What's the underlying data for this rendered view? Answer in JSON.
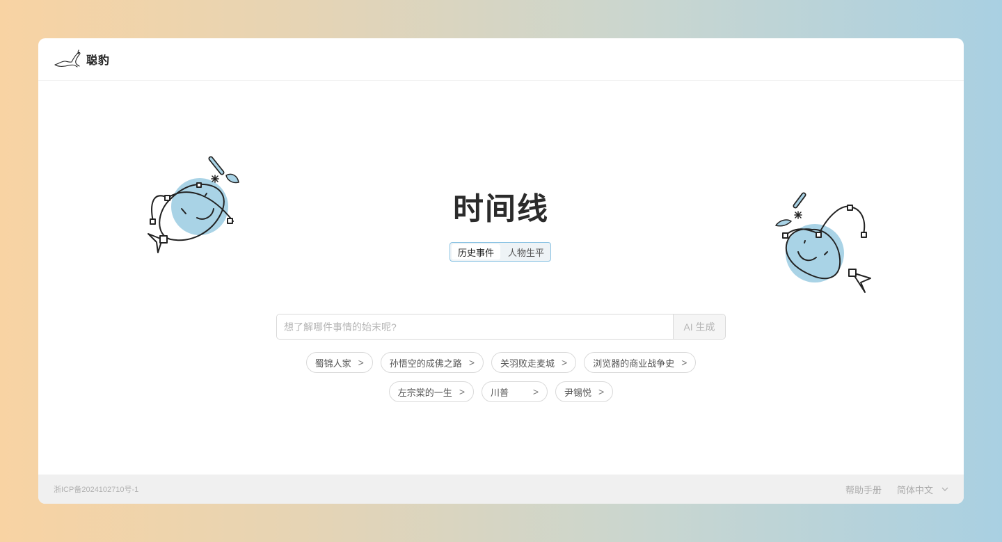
{
  "header": {
    "brand": "聪豹",
    "logo_icon": "seal-logo-icon"
  },
  "main": {
    "title": "时间线",
    "tabs": [
      {
        "label": "历史事件",
        "active": true
      },
      {
        "label": "人物生平",
        "active": false
      }
    ],
    "search": {
      "value": "",
      "placeholder": "想了解哪件事情的始末呢?",
      "button_label": "AI 生成"
    },
    "suggestions_row1": [
      "蜀锦人家",
      "孙悟空的成佛之路",
      "关羽败走麦城",
      "浏览器的商业战争史"
    ],
    "suggestions_row2": [
      "左宗棠的一生",
      "川普",
      "尹锡悦"
    ],
    "chip_icon": "chevron-right-icon"
  },
  "footer": {
    "icp": "浙ICP备2024102710号-1",
    "help": "帮助手册",
    "language": "简体中文",
    "language_icon": "chevron-down-icon"
  },
  "colors": {
    "accent_border": "#8bc3e3",
    "mascot_fill": "#a9d3e6",
    "footer_bg": "#f0f0f0"
  }
}
